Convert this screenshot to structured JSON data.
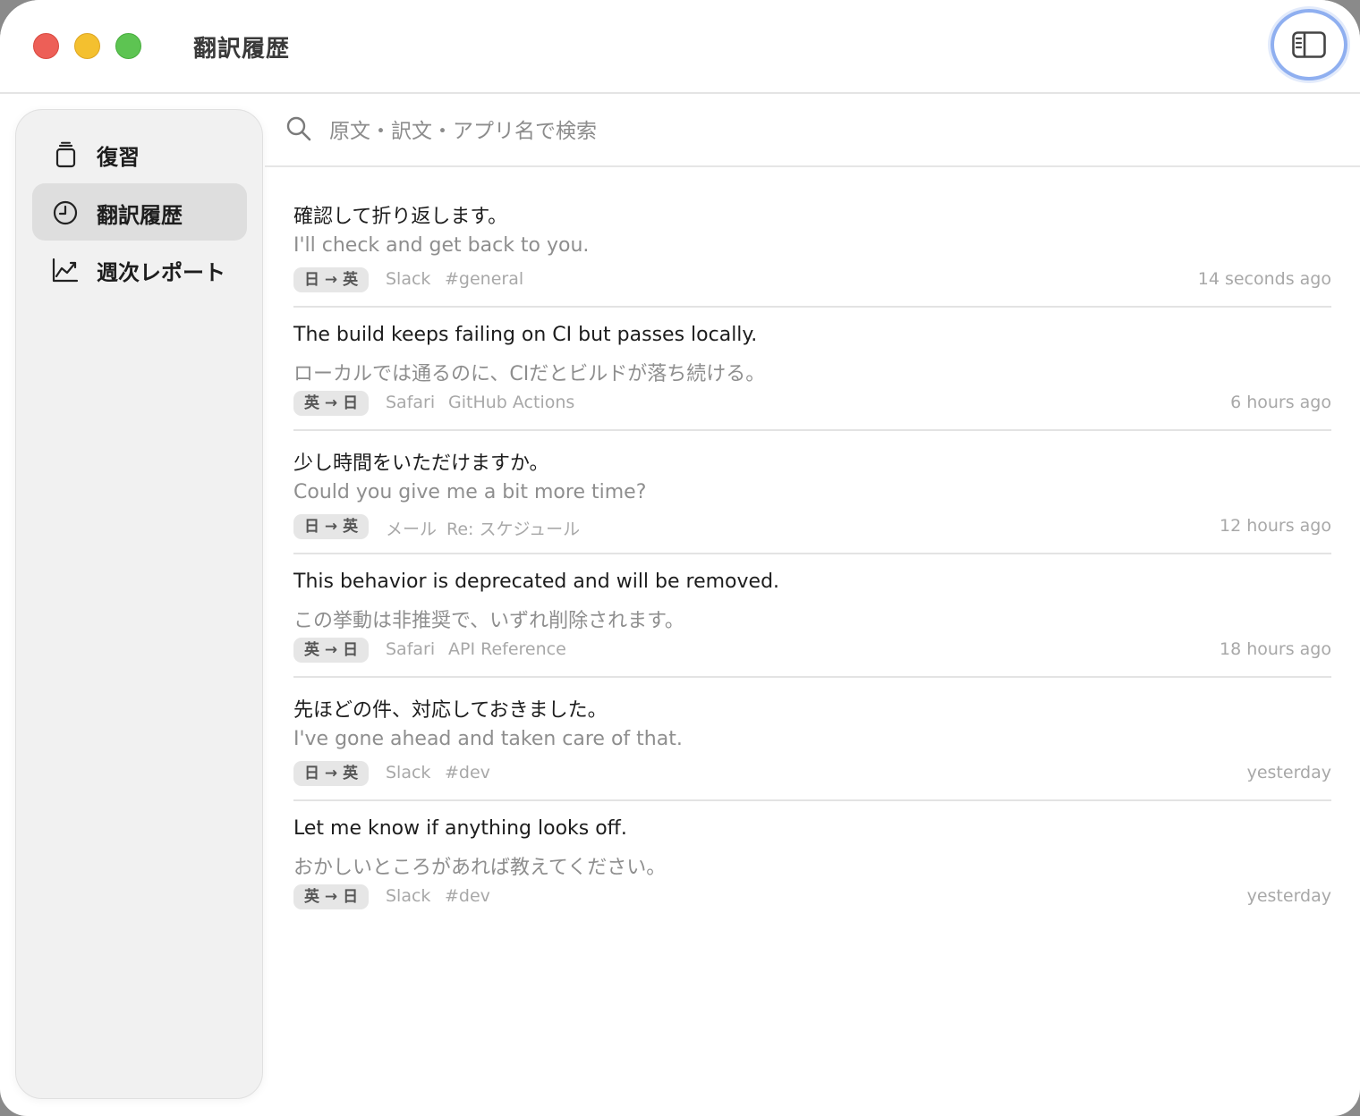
{
  "window": {
    "title": "翻訳履歴"
  },
  "sidebar": {
    "items": [
      {
        "label": "復習",
        "icon": "flashcard-icon",
        "active": false
      },
      {
        "label": "翻訳履歴",
        "icon": "clock-icon",
        "active": true
      },
      {
        "label": "週次レポート",
        "icon": "chart-line-icon",
        "active": false
      }
    ]
  },
  "search": {
    "placeholder": "原文・訳文・アプリ名で検索",
    "value": ""
  },
  "history": [
    {
      "source": "確認して折り返します。",
      "translation": "I'll check and get back to you.",
      "direction": "日 → 英",
      "app": "Slack",
      "context": "#general",
      "time": "14 seconds ago"
    },
    {
      "source": "The build keeps failing on CI but passes locally.",
      "translation": "ローカルでは通るのに、CIだとビルドが落ち続ける。",
      "direction": "英 → 日",
      "app": "Safari",
      "context": "GitHub Actions",
      "time": "6 hours ago"
    },
    {
      "source": "少し時間をいただけますか。",
      "translation": "Could you give me a bit more time?",
      "direction": "日 → 英",
      "app": "メール",
      "context": "Re: スケジュール",
      "time": "12 hours ago"
    },
    {
      "source": "This behavior is deprecated and will be removed.",
      "translation": "この挙動は非推奨で、いずれ削除されます。",
      "direction": "英 → 日",
      "app": "Safari",
      "context": "API Reference",
      "time": "18 hours ago"
    },
    {
      "source": "先ほどの件、対応しておきました。",
      "translation": "I've gone ahead and taken care of that.",
      "direction": "日 → 英",
      "app": "Slack",
      "context": "#dev",
      "time": "yesterday"
    },
    {
      "source": "Let me know if anything looks off.",
      "translation": "おかしいところがあれば教えてください。",
      "direction": "英 → 日",
      "app": "Slack",
      "context": "#dev",
      "time": "yesterday"
    }
  ],
  "colors": {
    "close": "#ed5f57",
    "minimize": "#f4c02f",
    "maximize": "#5dc452",
    "focus_ring": "#8faff0"
  }
}
